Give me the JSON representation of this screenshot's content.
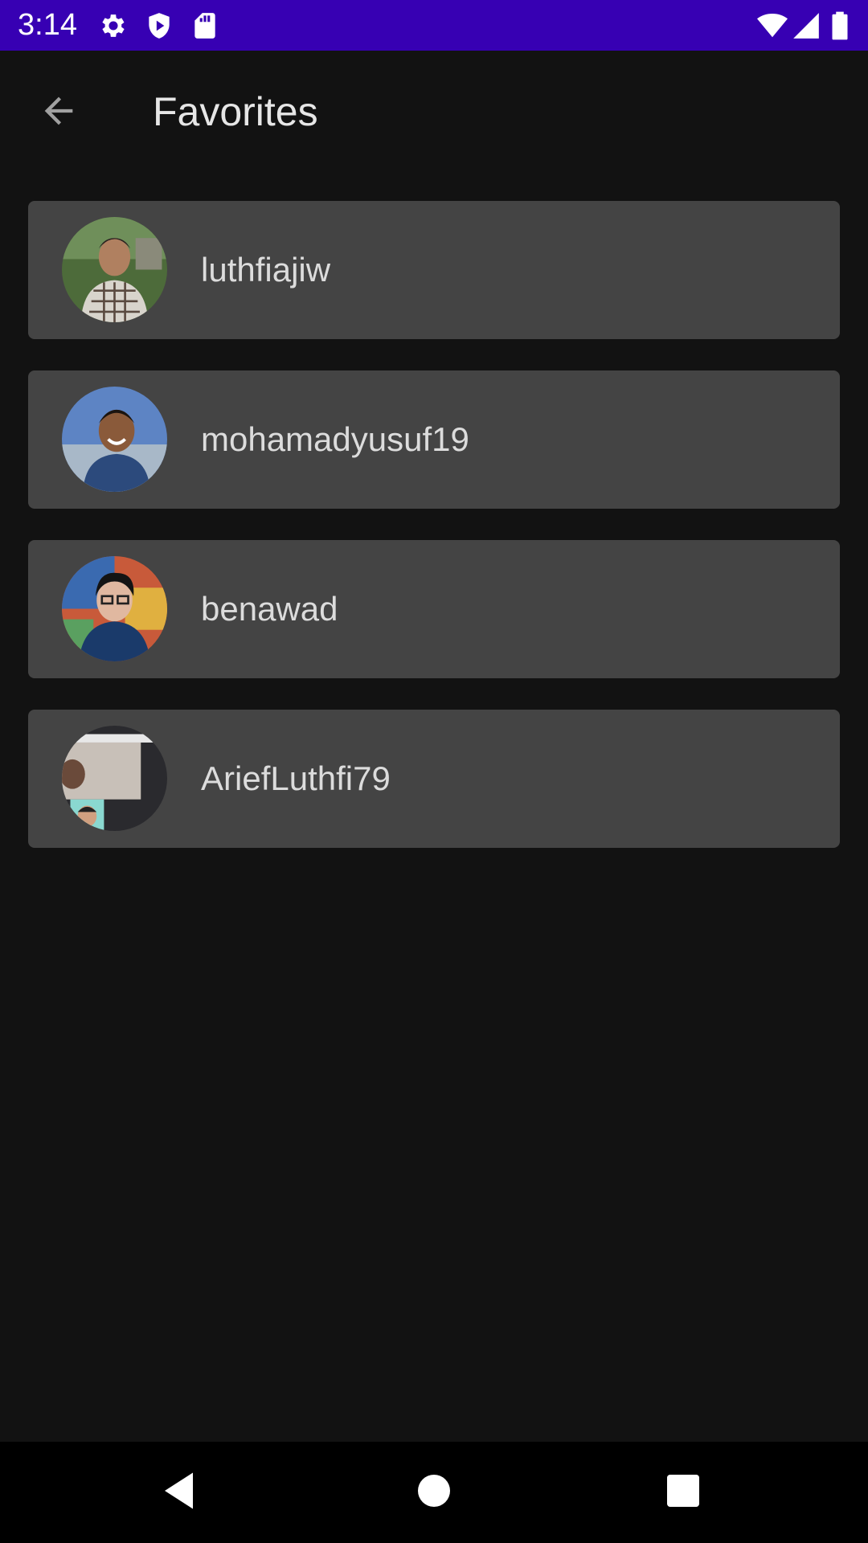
{
  "status_bar": {
    "time": "3:14",
    "icons": [
      "settings-icon",
      "play-protect-icon",
      "sd-card-icon",
      "wifi-icon",
      "signal-icon",
      "battery-icon"
    ],
    "background": "#3700B3"
  },
  "app_bar": {
    "title": "Favorites",
    "back_icon": "arrow-back-icon"
  },
  "favorites": [
    {
      "username": "luthfiajiw",
      "avatar": "avatar-photo"
    },
    {
      "username": "mohamadyusuf19",
      "avatar": "avatar-photo"
    },
    {
      "username": "benawad",
      "avatar": "avatar-photo"
    },
    {
      "username": "AriefLuthfi79",
      "avatar": "avatar-photo"
    }
  ],
  "colors": {
    "background": "#121212",
    "card": "#444444",
    "text": "#dcdcdc",
    "status_bar": "#3700B3"
  },
  "nav_bar": {
    "buttons": [
      "back-triangle-icon",
      "home-circle-icon",
      "recents-square-icon"
    ]
  }
}
